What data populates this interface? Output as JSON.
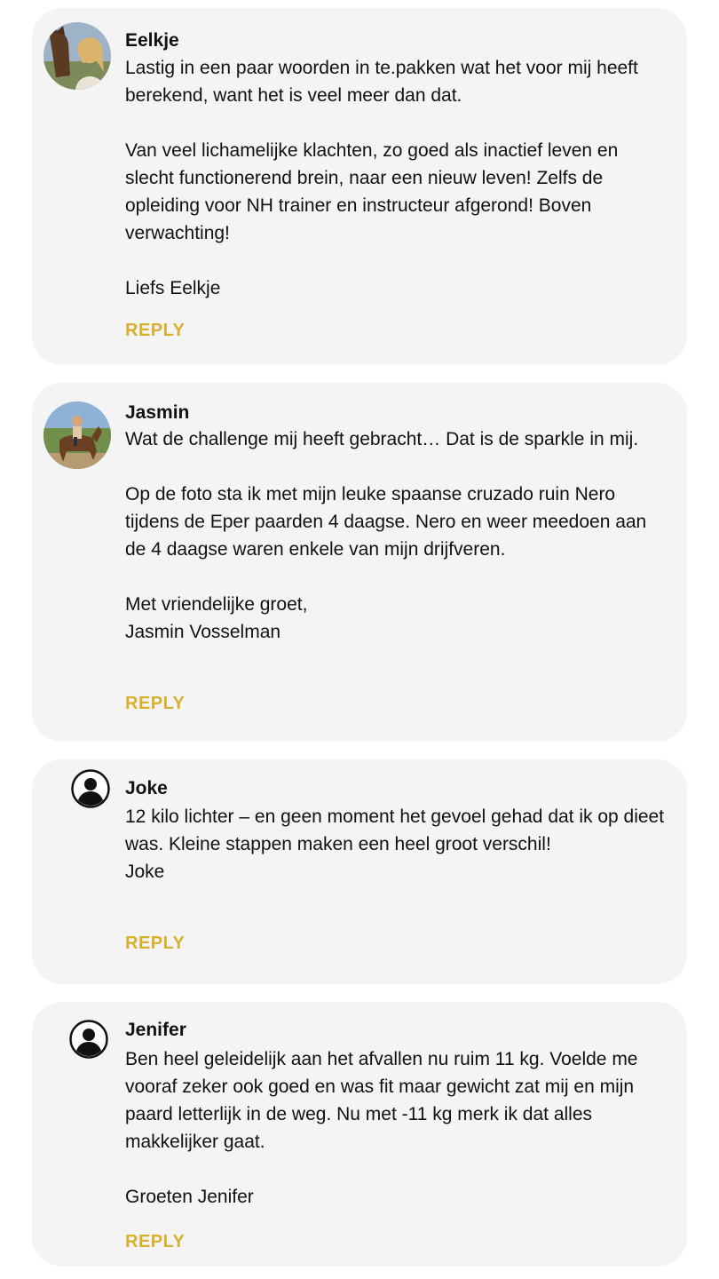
{
  "comments": [
    {
      "author": "Eelkje",
      "avatar": "profile-photo",
      "paragraphs": [
        "Lastig in een paar woorden in te.pakken wat het voor mij heeft berekend, want het is veel meer dan dat.",
        "Van veel lichamelijke klachten, zo goed als inactief leven en slecht functionerend brein, naar een nieuw leven! Zelfs de opleiding voor NH trainer en instructeur afgerond! Boven verwachting!",
        "Liefs Eelkje"
      ],
      "reply_label": "REPLY"
    },
    {
      "author": "Jasmin",
      "avatar": "profile-photo",
      "paragraphs": [
        "Wat de challenge mij heeft gebracht… Dat is de sparkle in mij.",
        "Op de foto sta ik met mijn leuke spaanse cruzado ruin Nero tijdens de Eper paarden 4 daagse. Nero en weer meedoen aan de 4 daagse waren enkele van mijn drijfveren.",
        "Met vriendelijke groet,\nJasmin Vosselman"
      ],
      "reply_label": "REPLY"
    },
    {
      "author": "Joke",
      "avatar": "default-user-icon",
      "paragraphs": [
        "12 kilo lichter – en geen moment het gevoel gehad dat ik op dieet was. Kleine stappen maken een heel groot verschil!\nJoke"
      ],
      "reply_label": "REPLY"
    },
    {
      "author": "Jenifer",
      "avatar": "default-user-icon",
      "paragraphs": [
        "Ben heel geleidelijk aan het afvallen nu ruim 11 kg. Voelde me vooraf zeker ook goed en was fit maar gewicht zat mij en mijn paard letterlijk in de weg. Nu met -11 kg merk ik dat alles makkelijker gaat.",
        "Groeten Jenifer"
      ],
      "reply_label": "REPLY"
    }
  ],
  "colors": {
    "card_background": "#f4f4f4",
    "reply": "#d8b02d",
    "text": "#111111"
  }
}
